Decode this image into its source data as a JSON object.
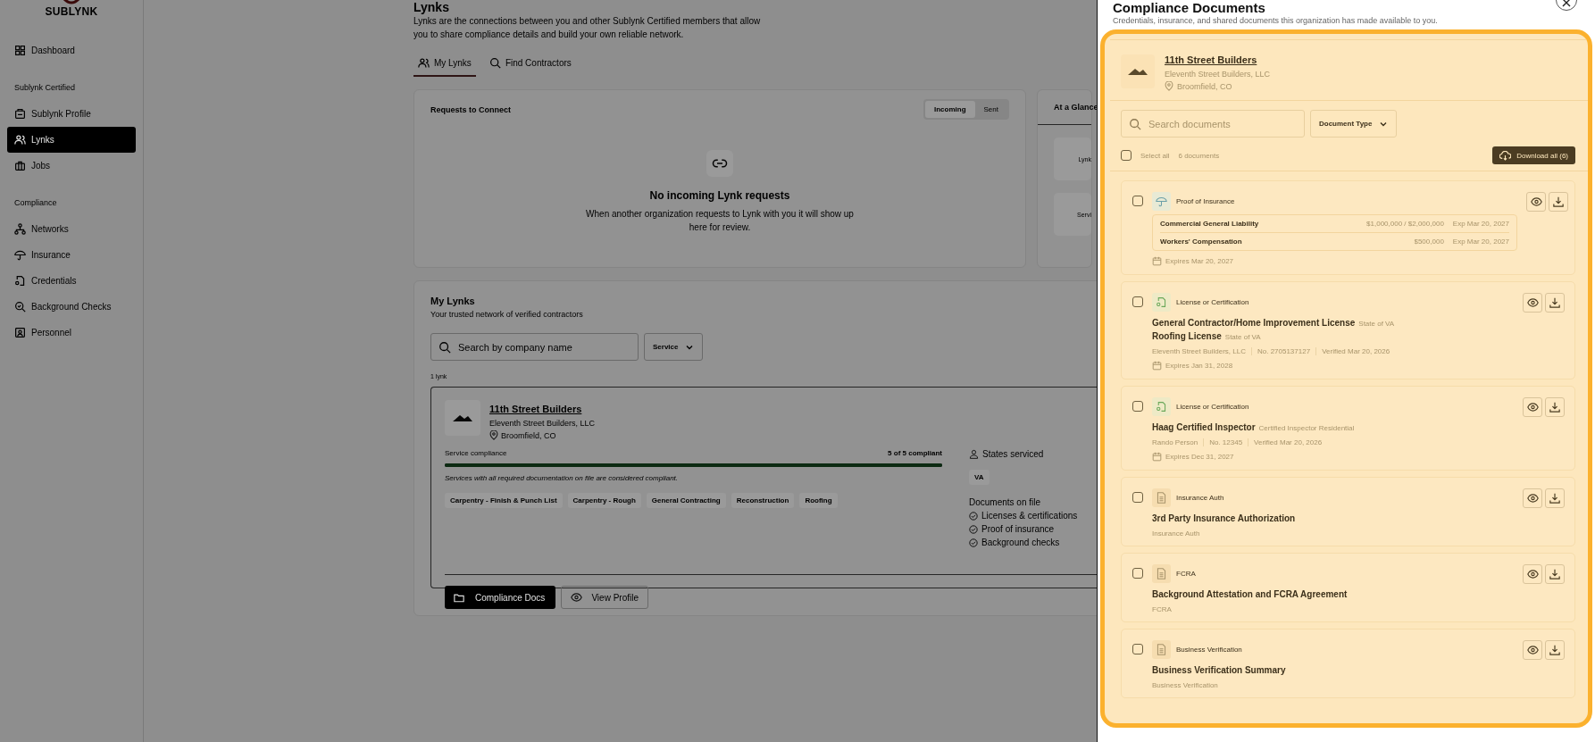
{
  "sidebar": {
    "logo": "SUBLYNK",
    "groups": [
      {
        "items": [
          {
            "label": "Dashboard",
            "selected": false
          }
        ]
      },
      {
        "heading": "Sublynk Certified",
        "items": [
          {
            "label": "Sublynk Profile",
            "selected": false
          },
          {
            "label": "Lynks",
            "selected": true
          },
          {
            "label": "Jobs",
            "selected": false
          }
        ]
      },
      {
        "heading": "Compliance",
        "items": [
          {
            "label": "Networks",
            "selected": false
          },
          {
            "label": "Insurance",
            "selected": false
          },
          {
            "label": "Credentials",
            "selected": false
          },
          {
            "label": "Background Checks",
            "selected": false
          },
          {
            "label": "Personnel",
            "selected": false
          }
        ]
      }
    ]
  },
  "main": {
    "title": "Lynks",
    "description": "Lynks are the connections between you and other Sublynk Certified members that allow you to share compliance details and build your own reliable network.",
    "tabs": [
      {
        "label": "My Lynks",
        "selected": true
      },
      {
        "label": "Find Contractors",
        "selected": false
      }
    ],
    "requests": {
      "title": "Requests to Connect",
      "toggle": [
        {
          "label": "Incoming",
          "selected": true
        },
        {
          "label": "Sent",
          "selected": false
        }
      ],
      "empty_title": "No incoming Lynk requests",
      "empty_text": "When another organization requests to Lynk with you it will show up here for review."
    },
    "glance": {
      "title": "At a Glance",
      "stats": [
        "Lynk",
        "Servi"
      ]
    },
    "my_lynks": {
      "title": "My Lynks",
      "subtitle": "Your trusted network of verified contractors",
      "search": {
        "placeholder": "Search by company name"
      },
      "filter": "Service",
      "count": "1 lynk",
      "lynks": [
        {
          "name": "11th Street Builders",
          "legal_name": "Eleventh Street Builders, LLC",
          "location": "Broomfield, CO",
          "compliance_label": "Service compliance",
          "compliance_count": "5 of 5 compliant",
          "level": 1,
          "compliance_note": "Services with all required documentation on file are considered compliant.",
          "services": [
            "Carpentry - Finish & Punch List",
            "Carpentry - Rough",
            "General Contracting",
            "Reconstruction",
            "Roofing"
          ],
          "states_label": "States serviced",
          "states": [
            "VA"
          ],
          "docs_label": "Documents on file",
          "docs": [
            "Licenses & certifications",
            "Proof of insurance",
            "Background checks"
          ],
          "primary_button": "Compliance Docs",
          "secondary_button": "View Profile"
        }
      ]
    }
  },
  "drawer": {
    "title": "Compliance Documents",
    "subtitle": "Credentials, insurance, and shared documents this organization has made available to you.",
    "company": {
      "name": "11th Street Builders",
      "legal_name": "Eleventh Street Builders, LLC",
      "location": "Broomfield, CO"
    },
    "search": {
      "placeholder": "Search documents"
    },
    "type_filter": "Document Type",
    "select_all": {
      "label": "Select all",
      "checked": false
    },
    "count": "6 documents",
    "download_all": "Download all (6)",
    "documents": [
      {
        "kind": "insurance",
        "type": "Proof of Insurance",
        "checked": false,
        "coverages": [
          {
            "name": "Commercial General Liability",
            "limits": "$1,000,000 / $2,000,000",
            "expires": "Exp Mar 20, 2027"
          },
          {
            "name": "Workers' Compensation",
            "limits": "$500,000",
            "expires": "Exp Mar 20, 2027"
          }
        ],
        "expires": "Expires Mar 20, 2027"
      },
      {
        "kind": "license",
        "type": "License or Certification",
        "checked": false,
        "titles": [
          {
            "name": "General Contractor/Home Improvement License",
            "detail": "State of VA"
          },
          {
            "name": "Roofing License",
            "detail": "State of VA"
          }
        ],
        "meta": [
          "Eleventh Street Builders, LLC",
          "No. 2705137127",
          "Verified Mar 20, 2026"
        ],
        "expires": "Expires Jan 31, 2028"
      },
      {
        "kind": "license",
        "type": "License or Certification",
        "checked": false,
        "titles": [
          {
            "name": "Haag Certified Inspector",
            "detail": "Certified Inspector Residential"
          }
        ],
        "meta": [
          "Rando Person",
          "No. 12345",
          "Verified Mar 20, 2026"
        ],
        "expires": "Expires Dec 31, 2027"
      },
      {
        "kind": "document",
        "type": "Insurance Auth",
        "checked": false,
        "titles": [
          {
            "name": "3rd Party Insurance Authorization"
          }
        ],
        "meta": [
          "Insurance Auth"
        ]
      },
      {
        "kind": "document",
        "type": "FCRA",
        "checked": false,
        "titles": [
          {
            "name": "Background Attestation and FCRA Agreement"
          }
        ],
        "meta": [
          "FCRA"
        ]
      },
      {
        "kind": "document",
        "type": "Business Verification",
        "checked": false,
        "titles": [
          {
            "name": "Business Verification Summary"
          }
        ],
        "meta": [
          "Business Verification"
        ]
      }
    ]
  }
}
